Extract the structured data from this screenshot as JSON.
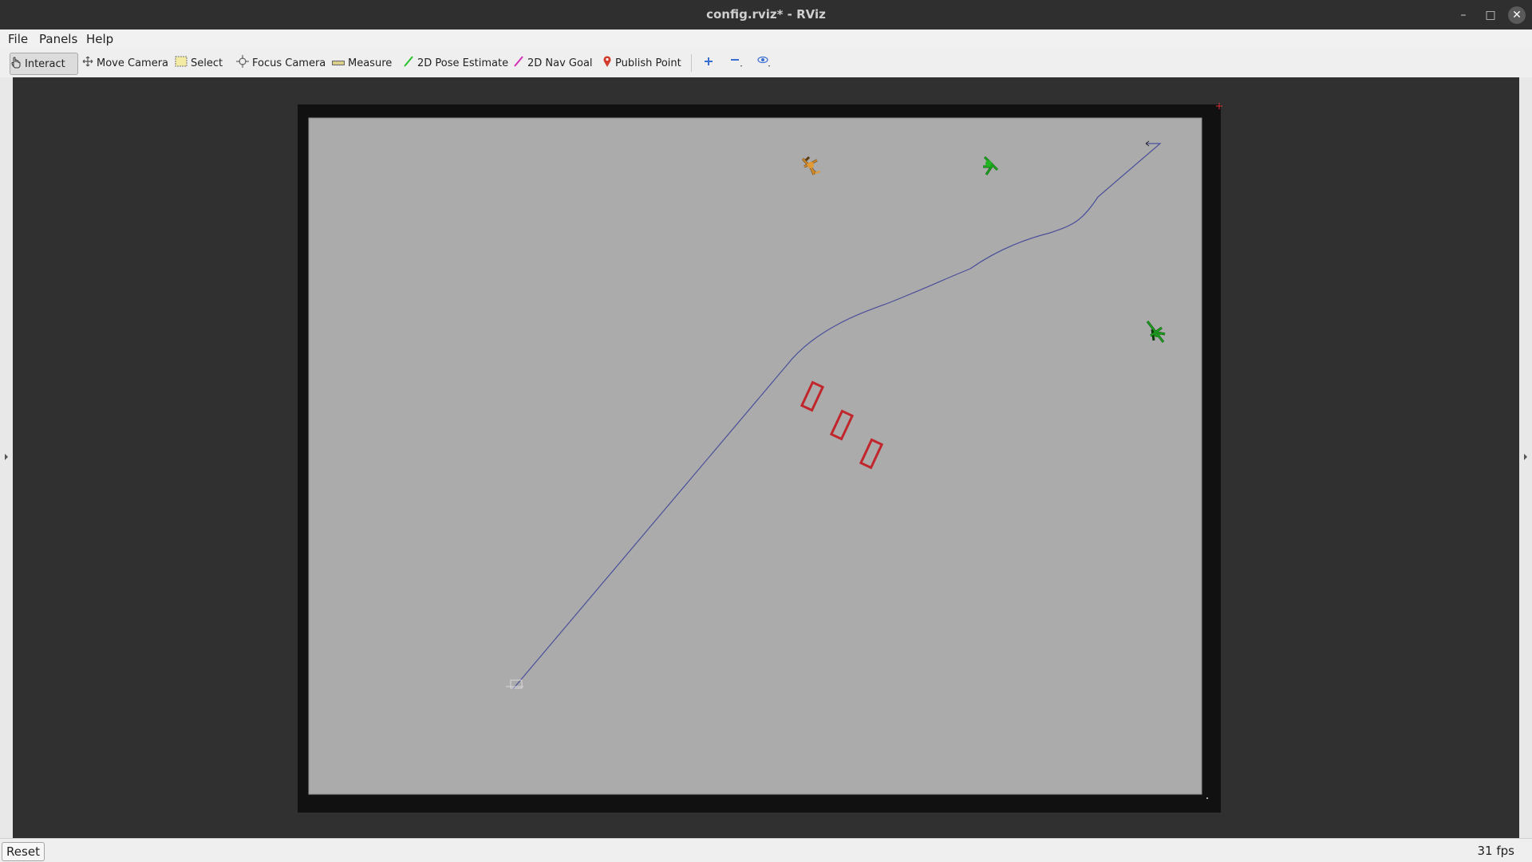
{
  "window": {
    "title": "config.rviz* - RViz"
  },
  "menu": {
    "file": "File",
    "panels": "Panels",
    "help": "Help"
  },
  "toolbar": {
    "interact": "Interact",
    "move_camera": "Move Camera",
    "select": "Select",
    "focus_camera": "Focus Camera",
    "measure": "Measure",
    "pose_estimate": "2D Pose Estimate",
    "nav_goal": "2D Nav Goal",
    "publish_point": "Publish Point"
  },
  "colors": {
    "map_free": "#ababab",
    "map_border": "#111111",
    "path": "#4a4f9a",
    "obstacles": "#c0262b",
    "agent_orange": "#d08a2b",
    "agent_green": "#1aa31a"
  },
  "status": {
    "reset": "Reset",
    "fps": "31 fps"
  }
}
